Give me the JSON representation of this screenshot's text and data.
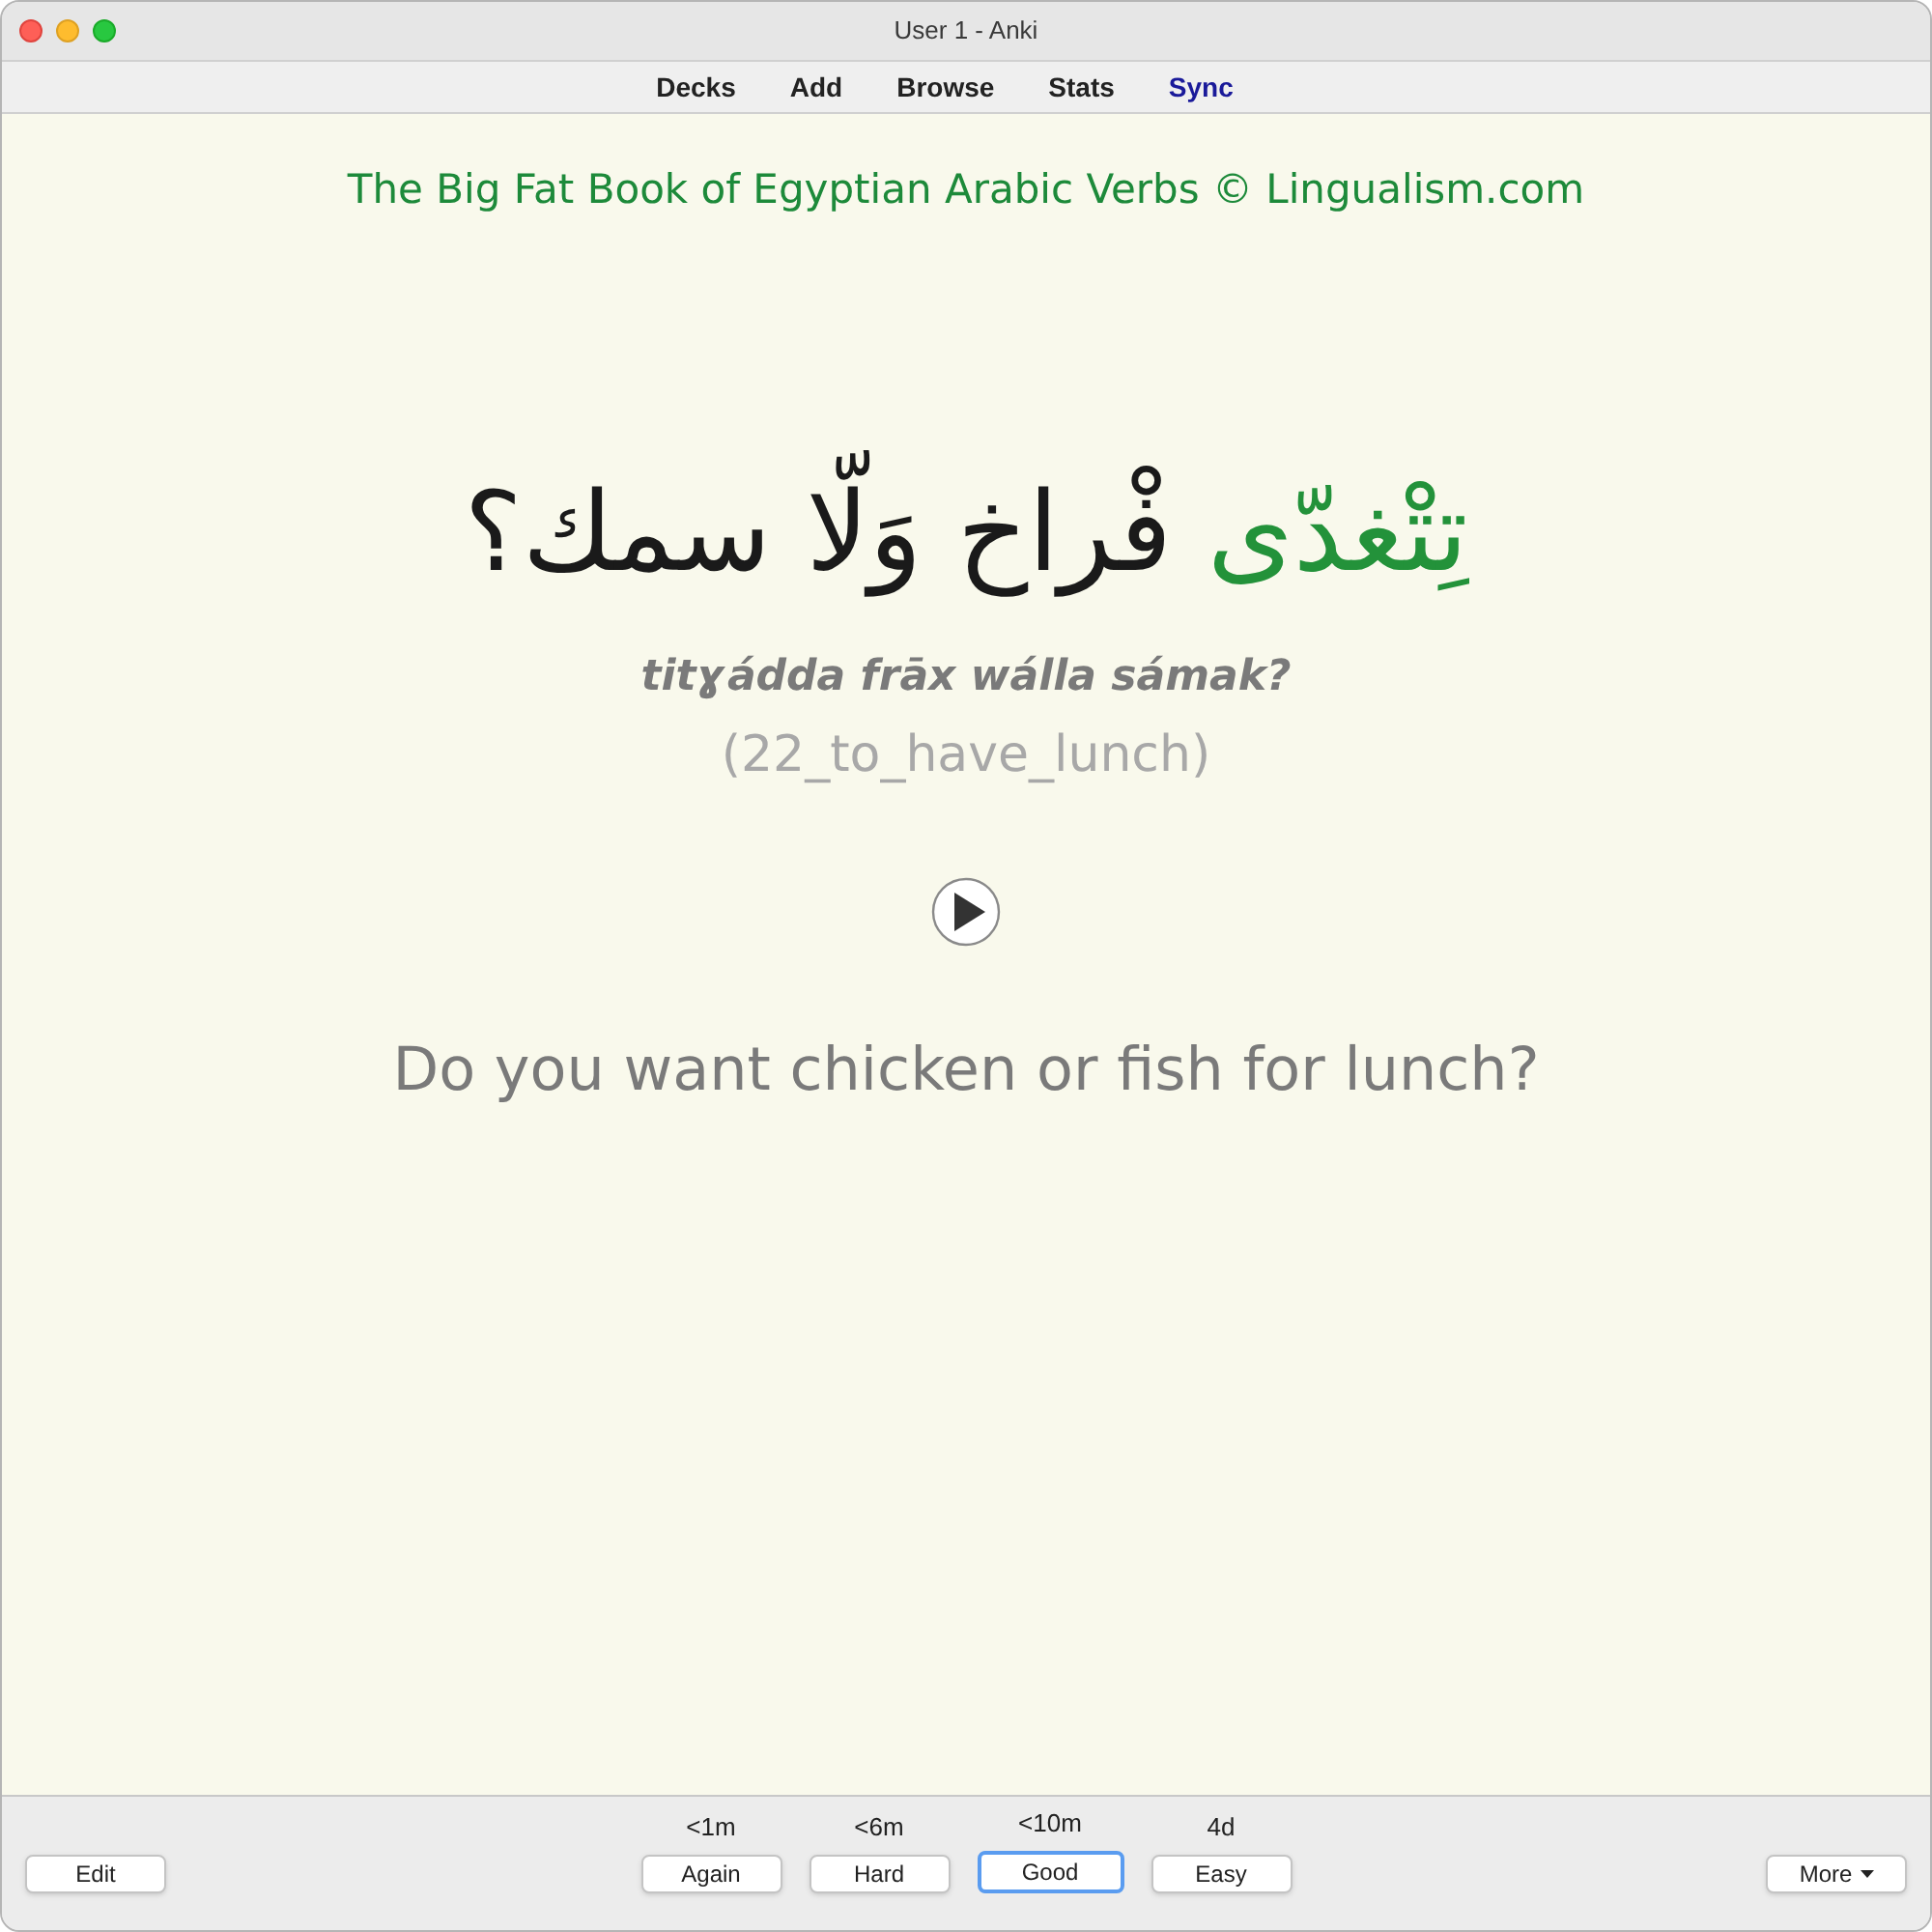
{
  "window": {
    "title": "User 1 - Anki"
  },
  "toolbar": [
    {
      "label": "Decks",
      "highlighted": false
    },
    {
      "label": "Add",
      "highlighted": false
    },
    {
      "label": "Browse",
      "highlighted": false
    },
    {
      "label": "Stats",
      "highlighted": false
    },
    {
      "label": "Sync",
      "highlighted": true
    }
  ],
  "card": {
    "header": "The Big Fat Book of Egyptian Arabic Verbs © Lingualism.com",
    "arabic": [
      {
        "text": "تِتْغدّى",
        "highlighted": true
      },
      {
        "text": "فْراخ وَلّا سمك؟",
        "highlighted": false
      }
    ],
    "transliteration": "titɣádda frāx wálla sámak?",
    "tag": "(22_to_have_lunch)",
    "translation": "Do you want chicken or fish for lunch?"
  },
  "bottom_bar": {
    "edit": "Edit",
    "answers": [
      {
        "interval": "<1m",
        "label": "Again",
        "selected": false
      },
      {
        "interval": "<6m",
        "label": "Hard",
        "selected": false
      },
      {
        "interval": "<10m",
        "label": "Good",
        "selected": true
      },
      {
        "interval": "4d",
        "label": "Easy",
        "selected": false
      }
    ],
    "more": "More"
  }
}
